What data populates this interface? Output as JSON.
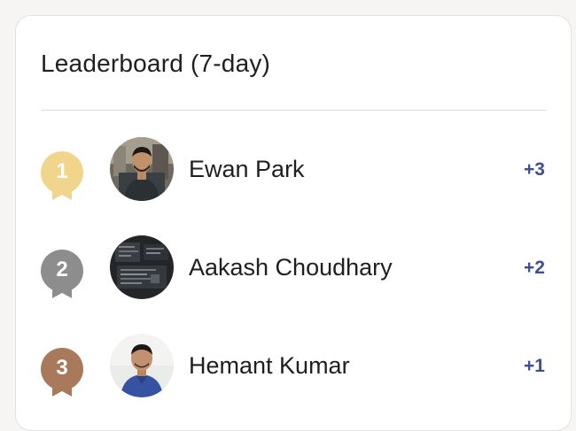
{
  "leaderboard": {
    "title": "Leaderboard (7-day)",
    "entries": [
      {
        "rank": "1",
        "name": "Ewan Park",
        "delta": "+3",
        "medal_color": "#f2d58c",
        "avatar": "person-photo"
      },
      {
        "rank": "2",
        "name": "Aakash Choudhary",
        "delta": "+2",
        "medal_color": "#8d8d8d",
        "avatar": "dark-screen-photo"
      },
      {
        "rank": "3",
        "name": "Hemant Kumar",
        "delta": "+1",
        "medal_color": "#a8795a",
        "avatar": "person-photo"
      }
    ]
  },
  "colors": {
    "delta": "#3f4f8f",
    "text": "#1f1f1f",
    "card_bg": "#ffffff",
    "page_bg": "#f6f5f3"
  }
}
